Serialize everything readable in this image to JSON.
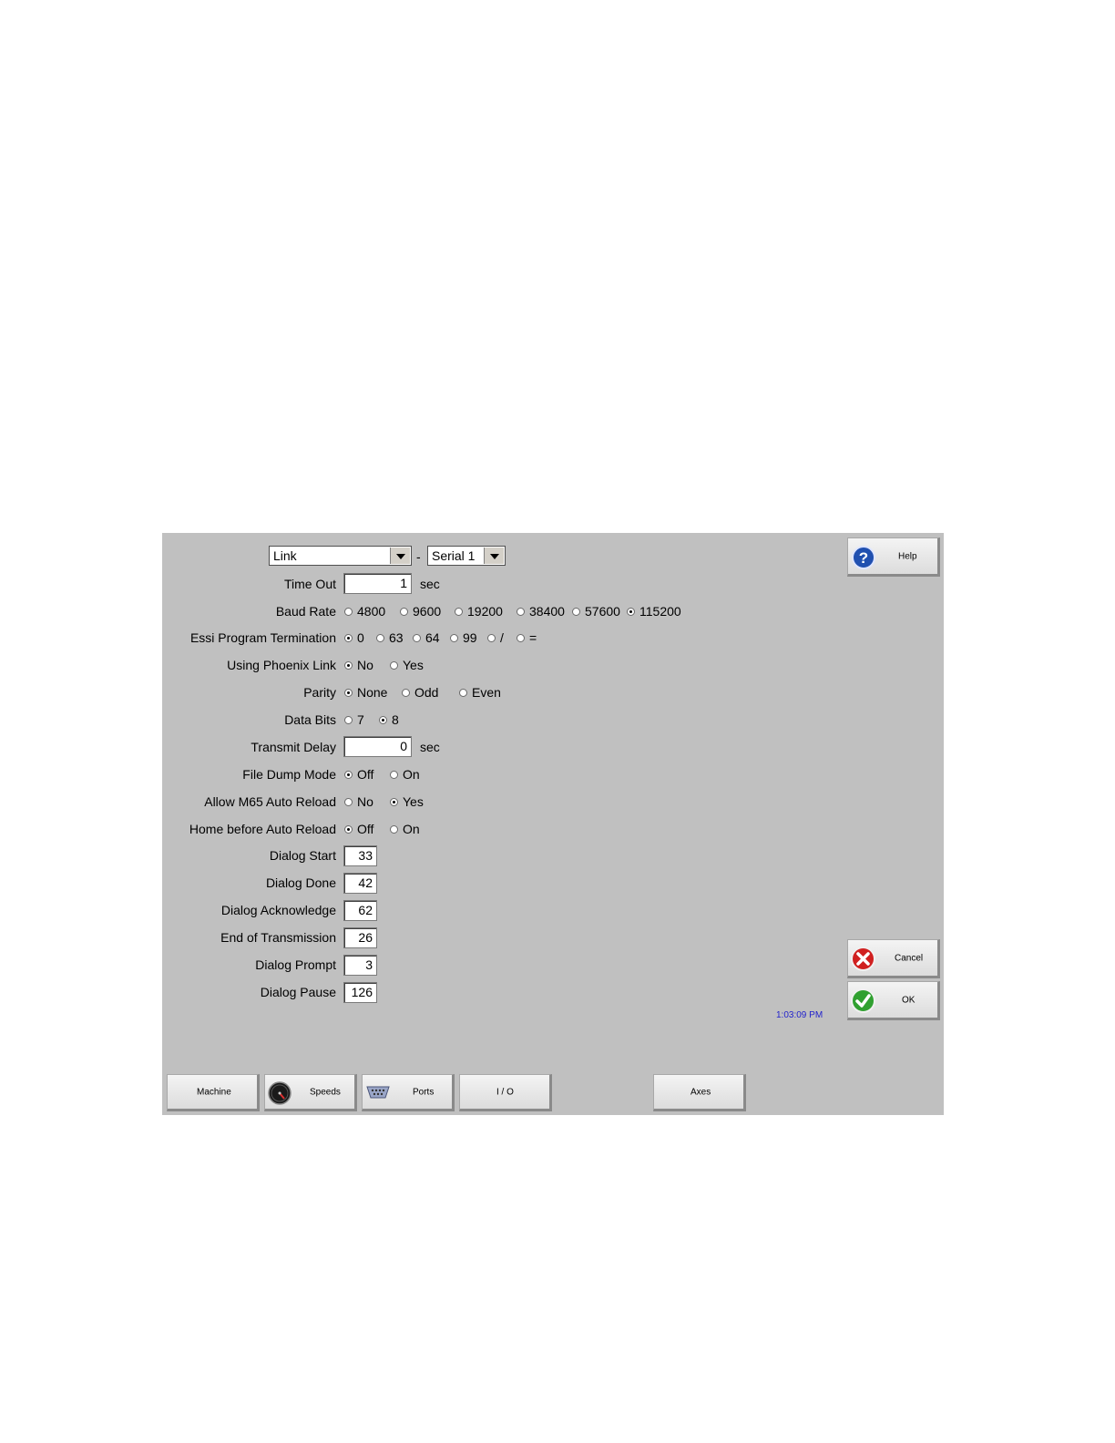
{
  "header": {
    "port_select": "Link",
    "separator": "-",
    "port_channel": "Serial 1"
  },
  "fields": {
    "time_out": {
      "label": "Time Out",
      "value": "1",
      "unit": "sec"
    },
    "baud_rate": {
      "label": "Baud Rate",
      "options": [
        "4800",
        "9600",
        "19200",
        "38400",
        "57600",
        "115200"
      ],
      "selected": "115200"
    },
    "essi_termination": {
      "label": "Essi Program Termination",
      "options": [
        "0",
        "63",
        "64",
        "99",
        "/",
        "="
      ],
      "selected": "0"
    },
    "phoenix_link": {
      "label": "Using Phoenix Link",
      "options": [
        "No",
        "Yes"
      ],
      "selected": "No"
    },
    "parity": {
      "label": "Parity",
      "options": [
        "None",
        "Odd",
        "Even"
      ],
      "selected": "None"
    },
    "data_bits": {
      "label": "Data Bits",
      "options": [
        "7",
        "8"
      ],
      "selected": "8"
    },
    "transmit_delay": {
      "label": "Transmit Delay",
      "value": "0",
      "unit": "sec"
    },
    "file_dump_mode": {
      "label": "File Dump Mode",
      "options": [
        "Off",
        "On"
      ],
      "selected": "Off"
    },
    "m65_reload": {
      "label": "Allow M65 Auto Reload",
      "options": [
        "No",
        "Yes"
      ],
      "selected": "Yes"
    },
    "home_before_reload": {
      "label": "Home before Auto Reload",
      "options": [
        "Off",
        "On"
      ],
      "selected": "Off"
    },
    "dialog_start": {
      "label": "Dialog Start",
      "value": "33"
    },
    "dialog_done": {
      "label": "Dialog Done",
      "value": "42"
    },
    "dialog_ack": {
      "label": "Dialog Acknowledge",
      "value": "62"
    },
    "end_transmission": {
      "label": "End of Transmission",
      "value": "26"
    },
    "dialog_prompt": {
      "label": "Dialog Prompt",
      "value": "3"
    },
    "dialog_pause": {
      "label": "Dialog Pause",
      "value": "126"
    }
  },
  "side_buttons": {
    "help": "Help",
    "cancel": "Cancel",
    "ok": "OK"
  },
  "status": {
    "clock": "1:03:09 PM"
  },
  "bottom_tabs": {
    "machine": "Machine",
    "speeds": "Speeds",
    "ports": "Ports",
    "io": "I / O",
    "axes": "Axes"
  },
  "colors": {
    "panel": "#c0c0c0",
    "clock": "#2222cc",
    "help_icon": "#2050b0",
    "cancel_icon": "#d02020",
    "ok_icon": "#30a030"
  }
}
